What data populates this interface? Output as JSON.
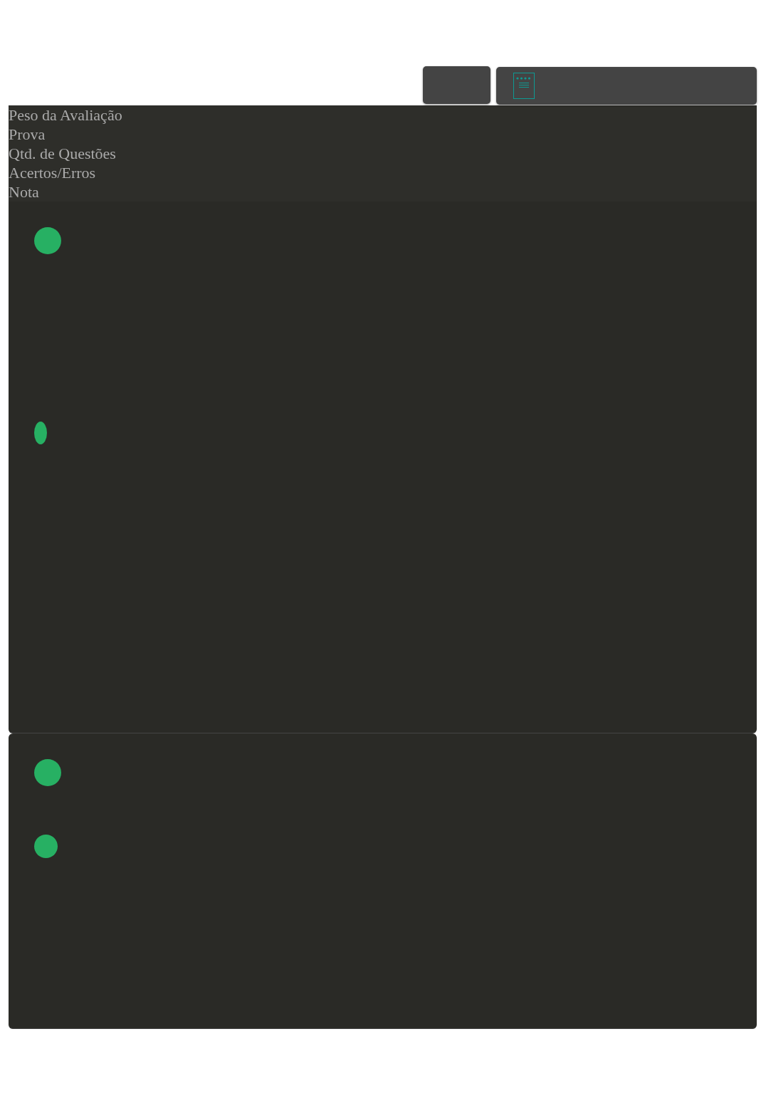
{
  "toolbar": {
    "buttons": [
      {
        "kind": "blank"
      },
      {
        "kind": "document"
      }
    ]
  },
  "header": {
    "labels": [
      "Peso da Avaliação",
      "Prova",
      "Qtd. de Questões",
      "Acertos/Erros",
      "Nota"
    ]
  },
  "cards": [
    {
      "markers": [
        {
          "kind": "large"
        },
        {
          "kind": "oval"
        }
      ]
    },
    {
      "markers": [
        {
          "kind": "large"
        },
        {
          "kind": "small"
        }
      ]
    }
  ]
}
